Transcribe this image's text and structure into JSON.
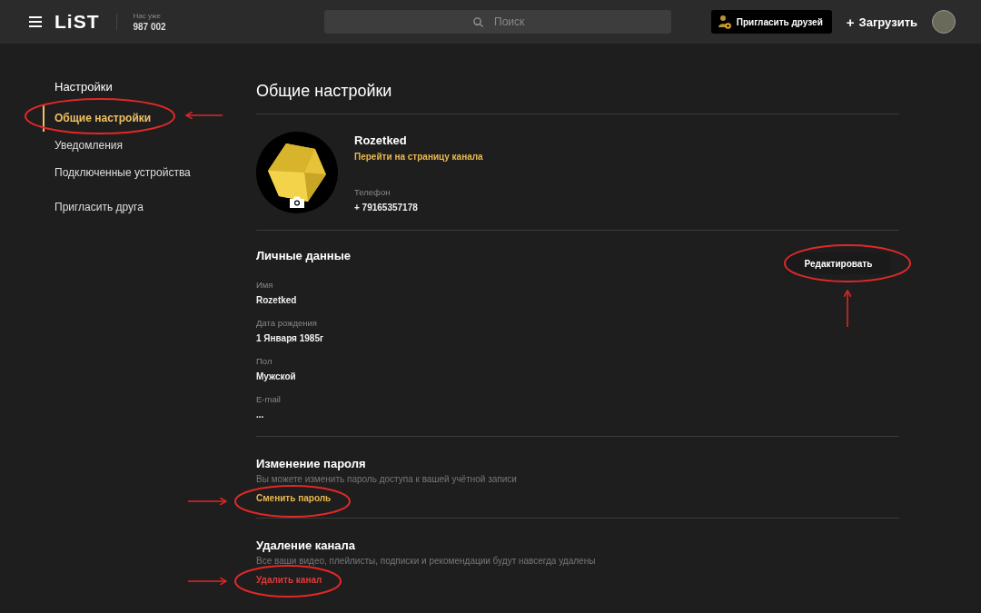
{
  "header": {
    "logo": "LiST",
    "counter_label": "Нас уже",
    "counter_value": "987 002",
    "search": {
      "placeholder": "Поиск"
    },
    "invite_button": "Пригласить друзей",
    "upload_button": "Загрузить",
    "upload_icon": "+"
  },
  "sidebar": {
    "title": "Настройки",
    "items": [
      {
        "label": "Общие настройки",
        "selected": true
      },
      {
        "label": "Уведомления",
        "selected": false
      },
      {
        "label": "Подключенные устройства",
        "selected": false
      },
      {
        "label": "Пригласить друга",
        "selected": false
      }
    ]
  },
  "page_title": "Общие настройки",
  "profile": {
    "name": "Rozetked",
    "channel_link": "Перейти на страницу канала",
    "phone_label": "Телефон",
    "phone": "+ 79165357178"
  },
  "personal": {
    "title": "Личные данные",
    "edit_button": "Редактировать",
    "fields": [
      {
        "label": "Имя",
        "value": "Rozetked"
      },
      {
        "label": "Дата рождения",
        "value": "1 Января 1985г"
      },
      {
        "label": "Пол",
        "value": "Мужской"
      },
      {
        "label": "E-mail",
        "value": "..."
      }
    ]
  },
  "password": {
    "title": "Изменение пароля",
    "description": "Вы можете изменить пароль доступа к вашей учётной записи",
    "link": "Сменить пароль"
  },
  "delete": {
    "title": "Удаление канала",
    "description": "Все ваши видео, плейлисты, подписки и рекомендации будут навсегда удалены",
    "link": "Удалить канал"
  }
}
